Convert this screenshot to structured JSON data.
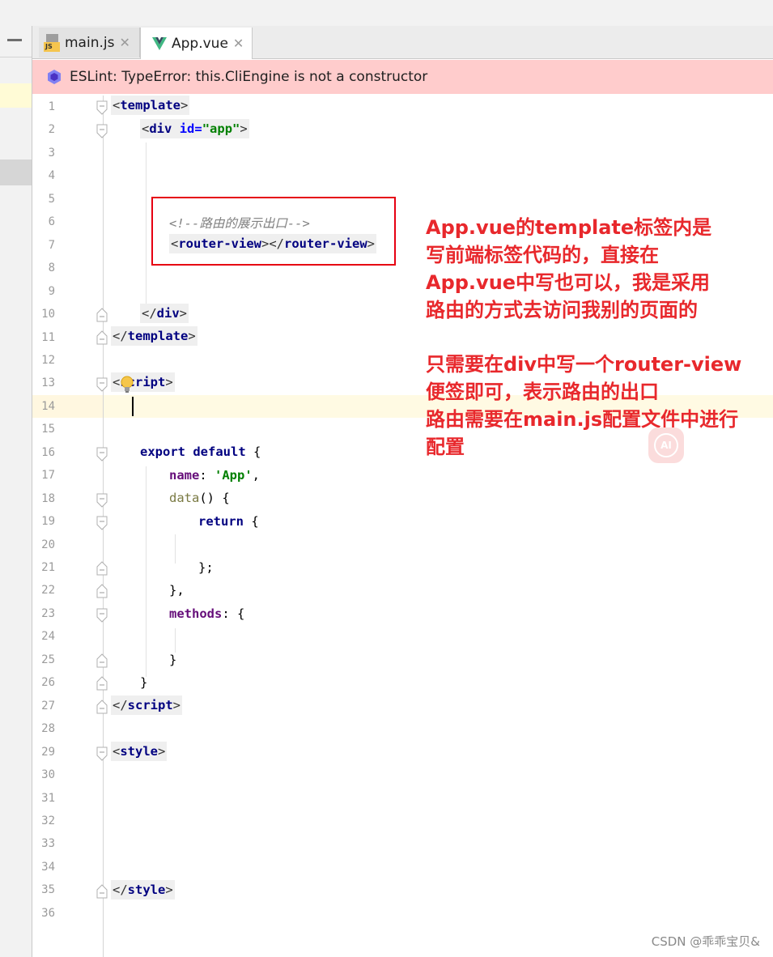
{
  "tabs": [
    {
      "label": "main.js",
      "icon": "js-file-icon"
    },
    {
      "label": "App.vue",
      "icon": "vue-file-icon",
      "active": true
    }
  ],
  "eslint_message": "ESLint: TypeError: this.CliEngine is not a constructor",
  "line_numbers": [
    "1",
    "2",
    "3",
    "4",
    "5",
    "6",
    "7",
    "8",
    "9",
    "10",
    "11",
    "12",
    "13",
    "14",
    "15",
    "16",
    "17",
    "18",
    "19",
    "20",
    "21",
    "22",
    "23",
    "24",
    "25",
    "26",
    "27",
    "28",
    "29",
    "30",
    "31",
    "32",
    "33",
    "34",
    "35",
    "36"
  ],
  "code": {
    "template": "template",
    "div": "div",
    "attr_id": "id",
    "attr_val": "\"app\"",
    "comment": "<!--路由的展示出口-->",
    "router_view": "router-view",
    "script": "script",
    "export_default": "export default",
    "name_key": "name",
    "name_val": "'App'",
    "data_fn": "data",
    "return_kw": "return",
    "methods_key": "methods",
    "style": "style"
  },
  "annotation": {
    "para1": "App.vue的template标签内是\n写前端标签代码的，直接在\nApp.vue中写也可以，我是采用\n路由的方式去访问我别的页面的",
    "para2": "只需要在div中写一个router-view\n便签即可，表示路由的出口\n路由需要在main.js配置文件中进行\n配置"
  },
  "ai_badge": "AI",
  "watermark": "CSDN @乖乖宝贝&",
  "colors": {
    "annotation_red": "#e8282c",
    "eslint_bg": "#ffcccc",
    "current_line": "#fffae3"
  }
}
